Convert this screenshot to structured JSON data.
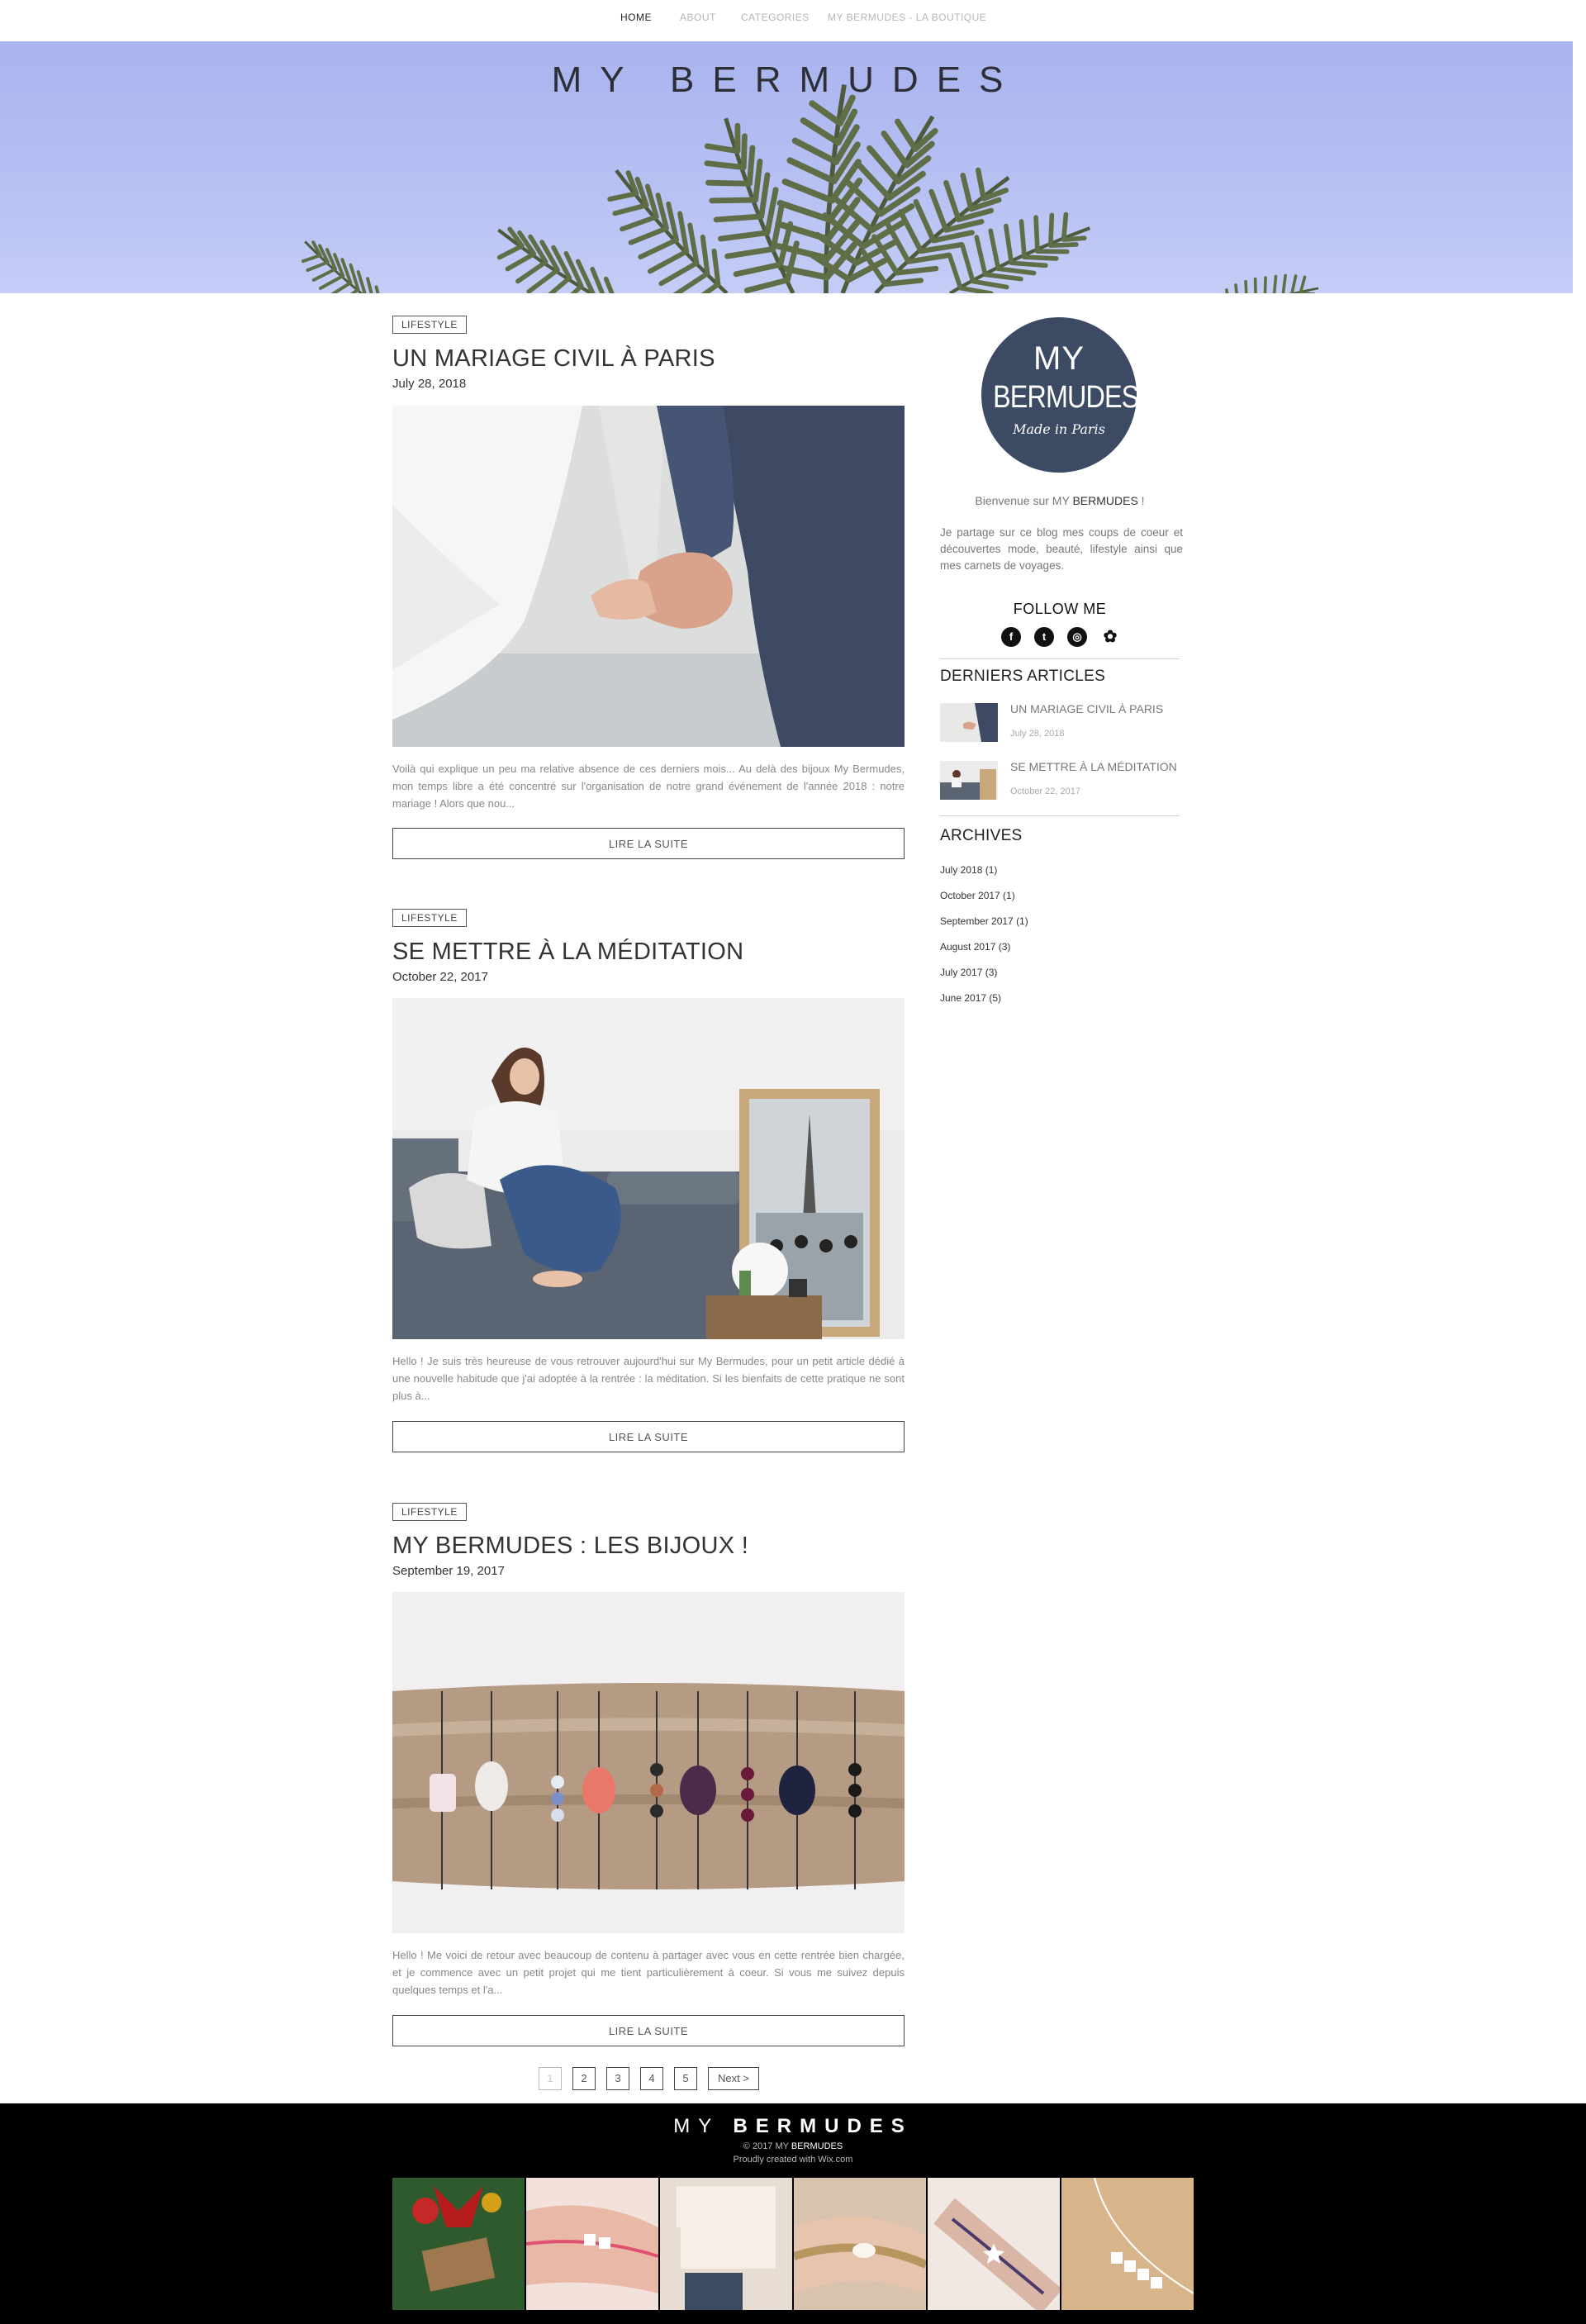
{
  "nav": {
    "items": [
      {
        "label": "HOME"
      },
      {
        "label": "ABOUT"
      },
      {
        "label": "CATEGORIES"
      },
      {
        "label": "MY BERMUDES - LA BOUTIQUE"
      }
    ]
  },
  "hero": {
    "title_light": "MY",
    "title_bold": "BERMUDES"
  },
  "posts": [
    {
      "tag": "LIFESTYLE",
      "title": "UN MARIAGE CIVIL À PARIS",
      "date": "July 28, 2018",
      "excerpt": "Voilà qui explique un peu ma relative absence de ces derniers mois... Au delà des bijoux My Bermudes, mon temps libre a été concentré sur l'organisation de notre grand événement de l'année 2018 : notre mariage ! Alors que nou...",
      "read_more": "LIRE LA SUITE"
    },
    {
      "tag": "LIFESTYLE",
      "title": "SE METTRE À LA MÉDITATION",
      "date": "October 22, 2017",
      "excerpt": "Hello ! Je suis très heureuse de vous retrouver aujourd'hui sur My Bermudes, pour un petit article dédié à une nouvelle habitude que j'ai adoptée à la rentrée : la méditation. Si les bienfaits de cette pratique ne sont plus à...",
      "read_more": "LIRE LA SUITE"
    },
    {
      "tag": "LIFESTYLE",
      "title": "MY BERMUDES : LES BIJOUX !",
      "date": "September 19, 2017",
      "excerpt": "Hello ! Me voici de retour avec beaucoup de contenu à partager avec vous en cette rentrée bien chargée, et je commence avec un petit projet qui me tient particulièrement à coeur. Si vous me suivez depuis quelques temps et l'a...",
      "read_more": "LIRE LA SUITE"
    }
  ],
  "pagination": {
    "pages": [
      "1",
      "2",
      "3",
      "4",
      "5"
    ],
    "next": "Next >",
    "current": "1"
  },
  "sidebar": {
    "logo": {
      "line1": "MY",
      "line2": "BERMUDES",
      "line3": "Made in Paris"
    },
    "welcome_prefix": "Bienvenue sur MY ",
    "welcome_bold": "BERMUDES",
    "welcome_suffix": " !",
    "intro": "Je partage sur ce blog mes coups de coeur et découvertes mode, beauté, lifestyle ainsi que mes carnets de voyages.",
    "follow_title": "FOLLOW ME",
    "social": [
      {
        "name": "facebook-icon",
        "glyph": "f"
      },
      {
        "name": "twitter-icon",
        "glyph": "t"
      },
      {
        "name": "instagram-icon",
        "glyph": "◎"
      },
      {
        "name": "flower-icon",
        "glyph": "✿"
      }
    ],
    "recent_title": "DERNIERS ARTICLES",
    "recent": [
      {
        "title": "UN MARIAGE CIVIL À PARIS",
        "date": "July 28, 2018"
      },
      {
        "title": "SE METTRE À LA MÉDITATION",
        "date": "October 22, 2017"
      }
    ],
    "archives_title": "ARCHIVES",
    "archives": [
      "July 2018 (1)",
      "October 2017 (1)",
      "September 2017 (1)",
      "August 2017 (3)",
      "July 2017 (3)",
      "June 2017 (5)"
    ]
  },
  "footer": {
    "title_light": "MY",
    "title_bold": "BERMUDES",
    "copyright_prefix": "© 2017 MY ",
    "copyright_bold": "BERMUDES",
    "credit": "Proudly created with Wix.com"
  },
  "colors": {
    "hero_sky": "#b0baf1",
    "logo_navy": "#3c4a63",
    "footer_bg": "#000000"
  }
}
